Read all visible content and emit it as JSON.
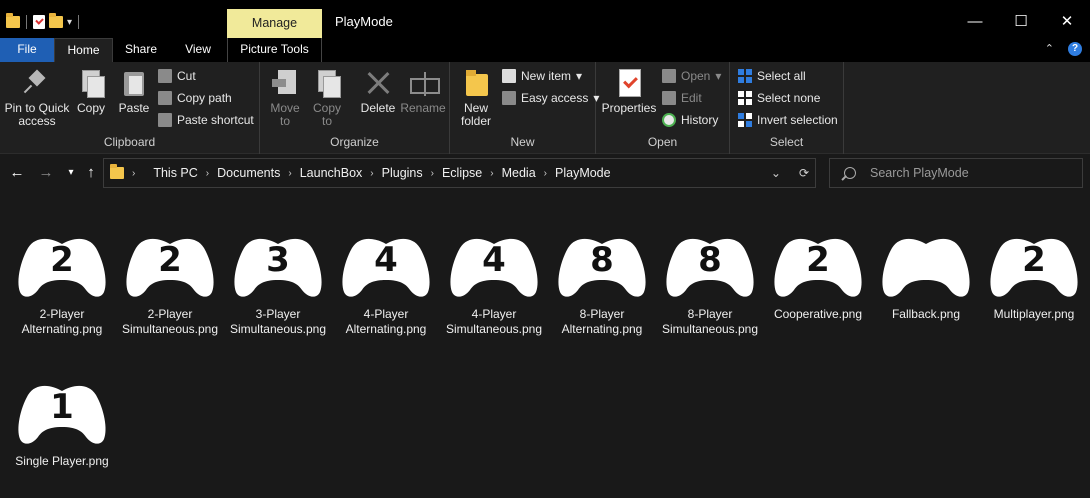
{
  "window": {
    "title": "PlayMode",
    "manage_label": "Manage",
    "controls": [
      "—",
      "☐",
      "✕"
    ]
  },
  "tabs": {
    "file": "File",
    "home": "Home",
    "share": "Share",
    "view": "View",
    "picture_tools": "Picture Tools"
  },
  "ribbon": {
    "clipboard": {
      "label": "Clipboard",
      "pin": "Pin to Quick access",
      "copy": "Copy",
      "paste": "Paste",
      "cut": "Cut",
      "copy_path": "Copy path",
      "paste_shortcut": "Paste shortcut"
    },
    "organize": {
      "label": "Organize",
      "move_to": "Move to",
      "copy_to": "Copy to",
      "delete": "Delete",
      "rename": "Rename"
    },
    "new": {
      "label": "New",
      "new_folder": "New folder",
      "new_item": "New item",
      "easy_access": "Easy access"
    },
    "open": {
      "label": "Open",
      "properties": "Properties",
      "open": "Open",
      "edit": "Edit",
      "history": "History"
    },
    "select": {
      "label": "Select",
      "select_all": "Select all",
      "select_none": "Select none",
      "invert_selection": "Invert selection"
    }
  },
  "address": {
    "breadcrumbs": [
      "This PC",
      "Documents",
      "LaunchBox",
      "Plugins",
      "Eclipse",
      "Media",
      "PlayMode"
    ]
  },
  "search": {
    "placeholder": "Search PlayMode"
  },
  "files": [
    {
      "name": "2-Player Alternating.png",
      "number": "2"
    },
    {
      "name": "2-Player Simultaneous.png",
      "number": "2"
    },
    {
      "name": "3-Player Simultaneous.png",
      "number": "3"
    },
    {
      "name": "4-Player Alternating.png",
      "number": "4"
    },
    {
      "name": "4-Player Simultaneous.png",
      "number": "4"
    },
    {
      "name": "8-Player Alternating.png",
      "number": "8"
    },
    {
      "name": "8-Player Simultaneous.png",
      "number": "8"
    },
    {
      "name": "Cooperative.png",
      "number": "2"
    },
    {
      "name": "Fallback.png",
      "number": ""
    },
    {
      "name": "Multiplayer.png",
      "number": "2"
    },
    {
      "name": "Single Player.png",
      "number": "1"
    }
  ],
  "colors": {
    "file_tab": "#1f5fb4",
    "manage_tab": "#f1ea9a",
    "background": "#191919",
    "ribbon": "#202020"
  }
}
